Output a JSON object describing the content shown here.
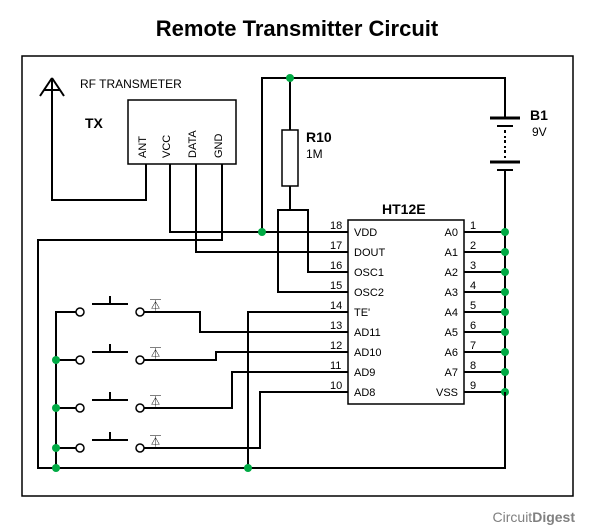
{
  "title": "Remote Transmitter Circuit",
  "tx": {
    "label": "TX",
    "caption": "RF TRANSMETER",
    "pins": [
      "ANT",
      "VCC",
      "DATA",
      "GND"
    ]
  },
  "resistor": {
    "ref": "R10",
    "value": "1M"
  },
  "battery": {
    "ref": "B1",
    "value": "9V"
  },
  "ic": {
    "ref": "HT12E",
    "left": [
      "VDD",
      "DOUT",
      "OSC1",
      "OSC2",
      "TE'",
      "AD11",
      "AD10",
      "AD9",
      "AD8"
    ],
    "leftNums": [
      "18",
      "17",
      "16",
      "15",
      "14",
      "13",
      "12",
      "11",
      "10"
    ],
    "right": [
      "A0",
      "A1",
      "A2",
      "A3",
      "A4",
      "A5",
      "A6",
      "A7",
      "VSS"
    ],
    "rightNums": [
      "1",
      "2",
      "3",
      "4",
      "5",
      "6",
      "7",
      "8",
      "9"
    ]
  },
  "switch_glyph": "⏄",
  "watermark": {
    "a": "Circuit",
    "b": "Digest"
  }
}
